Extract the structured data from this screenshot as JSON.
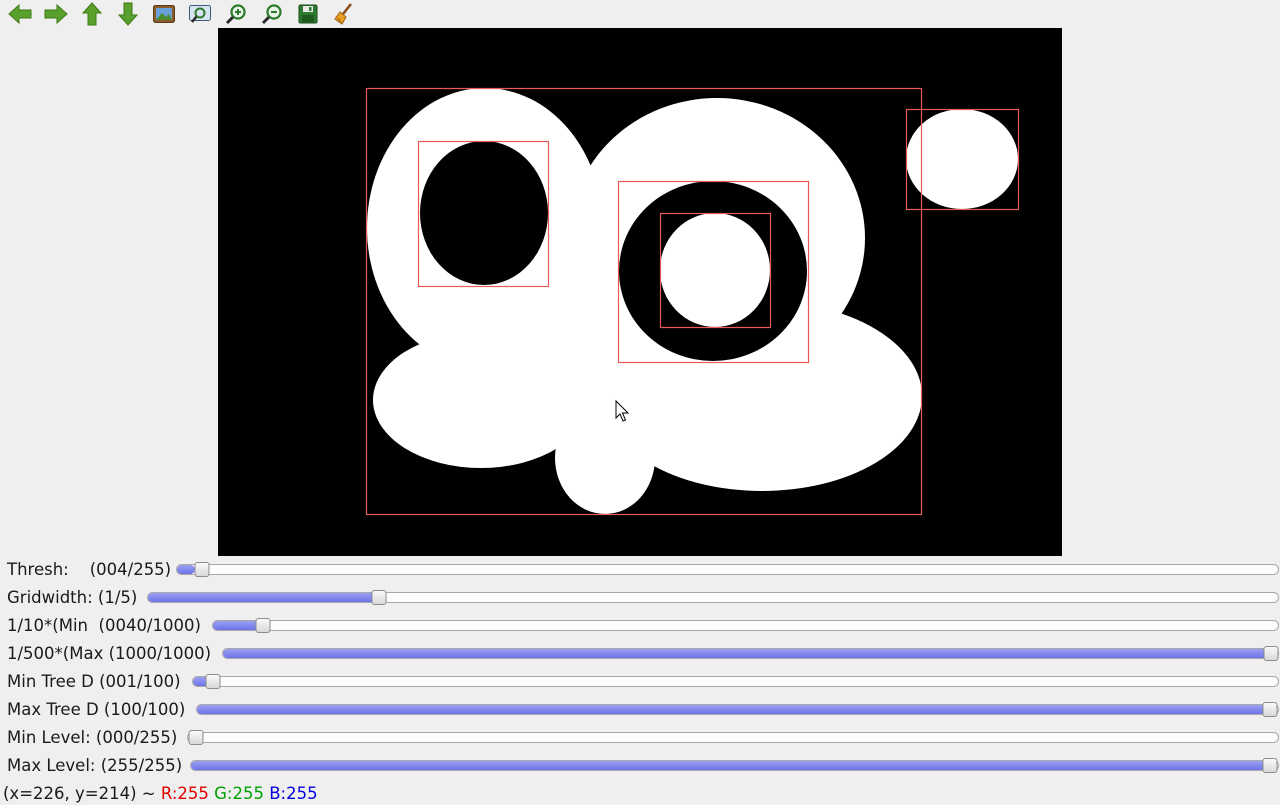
{
  "toolbar": {
    "buttons": [
      {
        "name": "pan-left-icon"
      },
      {
        "name": "pan-right-icon"
      },
      {
        "name": "pan-up-icon"
      },
      {
        "name": "pan-down-icon"
      },
      {
        "name": "zoom-reset-icon"
      },
      {
        "name": "zoom-x30-icon"
      },
      {
        "name": "zoom-in-icon"
      },
      {
        "name": "zoom-out-icon"
      },
      {
        "name": "save-icon"
      },
      {
        "name": "properties-icon"
      }
    ],
    "colors": {
      "arrow": "#5aa02c",
      "arrow_dark": "#3c7a16",
      "lens": "#3a8a2a"
    }
  },
  "image": {
    "background": "#000000",
    "foreground": "#ffffff",
    "box_color": "#e85a5a"
  },
  "sliders": [
    {
      "label": "Thresh:    (004/255)",
      "value": 4,
      "max": 255
    },
    {
      "label": "Gridwidth: (1/5)",
      "value": 1,
      "max": 5
    },
    {
      "label": "1/10*(Min  (0040/1000)",
      "value": 40,
      "max": 1000
    },
    {
      "label": "1/500*(Max (1000/1000)",
      "value": 1000,
      "max": 1000
    },
    {
      "label": "Min Tree D (001/100)",
      "value": 1,
      "max": 100
    },
    {
      "label": "Max Tree D (100/100)",
      "value": 100,
      "max": 100
    },
    {
      "label": "Min Level: (000/255)",
      "value": 0,
      "max": 255
    },
    {
      "label": "Max Level: (255/255)",
      "value": 255,
      "max": 255
    }
  ],
  "status": {
    "coords": "(x=226, y=214) ~ ",
    "r": "R:255",
    "g": "G:255",
    "b": "B:255"
  }
}
